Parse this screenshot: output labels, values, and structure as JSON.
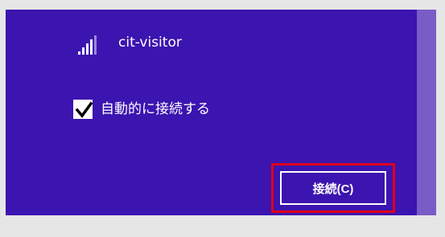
{
  "network": {
    "ssid": "cit-visitor",
    "signal_icon": "wifi-signal-icon",
    "auto_connect": {
      "label": "自動的に接続する",
      "checked": true
    },
    "connect_button": {
      "label": "接続(C)"
    }
  },
  "colors": {
    "panel": "#3c14b0",
    "scrollbar": "#7a5cc6",
    "highlight": "#e0001b"
  }
}
